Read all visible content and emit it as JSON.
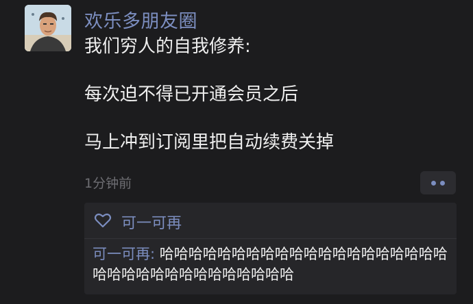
{
  "post": {
    "username": "欢乐多朋友圈",
    "lines": [
      "我们穷人的自我修养:",
      "每次迫不得已开通会员之后",
      "马上冲到订阅里把自动续费关掉"
    ],
    "time": "1分钟前"
  },
  "likes": {
    "names": "可一可再"
  },
  "comment": {
    "author": "可一可再",
    "separator": ": ",
    "text": "哈哈哈哈哈哈哈哈哈哈哈哈哈哈哈哈哈哈哈哈哈哈哈哈哈哈哈哈哈哈哈哈哈哈"
  },
  "icons": {
    "avatar": "avatar-portrait",
    "like": "heart-outline-icon",
    "more": "two-dot-more-icon"
  },
  "colors": {
    "background": "#1c1c1e",
    "link": "#7c8ec0",
    "text": "#efefef",
    "muted": "#6e6e73",
    "panel": "#262629"
  }
}
